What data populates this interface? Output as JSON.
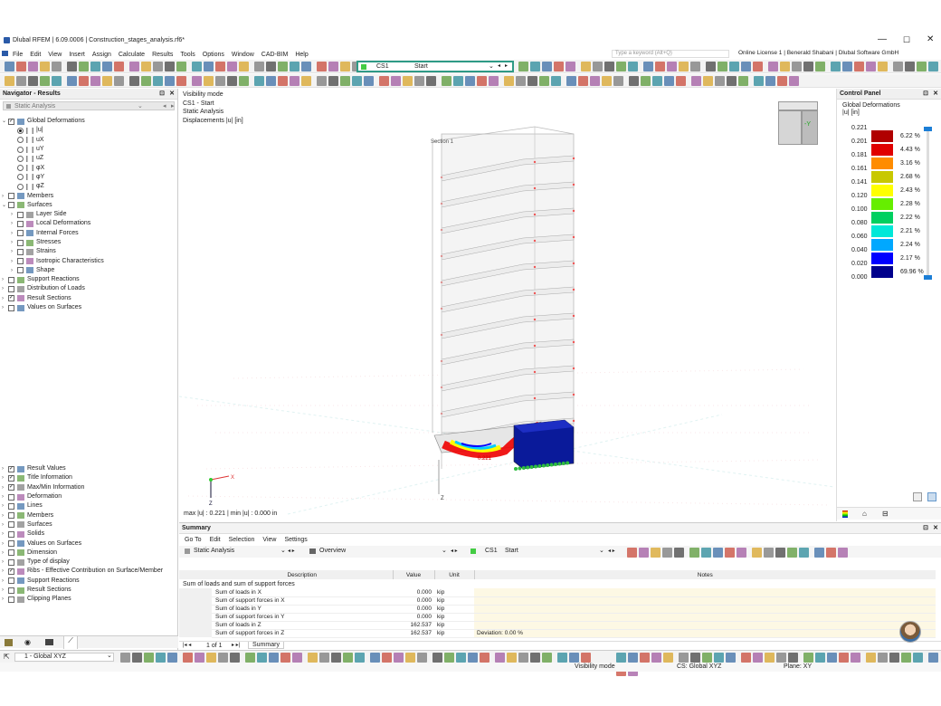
{
  "window": {
    "title": "Dlubal RFEM | 6.09.0006 | Construction_stages_analysis.rf6*"
  },
  "menu": [
    "File",
    "Edit",
    "View",
    "Insert",
    "Assign",
    "Calculate",
    "Results",
    "Tools",
    "Options",
    "Window",
    "CAD-BIM",
    "Help"
  ],
  "search": {
    "placeholder": "Type a keyword (Alt+Q)"
  },
  "license": "Online License 1 | Benerald Shabani | Dlubal Software GmbH",
  "construction_stage": {
    "id": "CS1",
    "name": "Start"
  },
  "navigator": {
    "title": "Navigator - Results",
    "analysis": "Static Analysis",
    "tree_top": [
      {
        "label": "Global Deformations",
        "level": 0,
        "checked": true,
        "expanded": true
      },
      {
        "label": "|u|",
        "level": 1,
        "radio": true,
        "selected": true
      },
      {
        "label": "uX",
        "level": 1,
        "radio": true
      },
      {
        "label": "uY",
        "level": 1,
        "radio": true
      },
      {
        "label": "uZ",
        "level": 1,
        "radio": true
      },
      {
        "label": "φX",
        "level": 1,
        "radio": true
      },
      {
        "label": "φY",
        "level": 1,
        "radio": true
      },
      {
        "label": "φZ",
        "level": 1,
        "radio": true
      },
      {
        "label": "Members",
        "level": 0,
        "checked": false
      },
      {
        "label": "Surfaces",
        "level": 0,
        "checked": false,
        "expanded": true
      },
      {
        "label": "Layer Side",
        "level": 1,
        "checked": false
      },
      {
        "label": "Local Deformations",
        "level": 1,
        "checked": false
      },
      {
        "label": "Internal Forces",
        "level": 1,
        "checked": false
      },
      {
        "label": "Stresses",
        "level": 1,
        "checked": false
      },
      {
        "label": "Strains",
        "level": 1,
        "checked": false
      },
      {
        "label": "Isotropic Characteristics",
        "level": 1,
        "checked": false
      },
      {
        "label": "Shape",
        "level": 1,
        "checked": false
      },
      {
        "label": "Support Reactions",
        "level": 0,
        "checked": false
      },
      {
        "label": "Distribution of Loads",
        "level": 0,
        "checked": false
      },
      {
        "label": "Result Sections",
        "level": 0,
        "checked": true
      },
      {
        "label": "Values on Surfaces",
        "level": 0,
        "checked": false
      }
    ],
    "tree_bottom": [
      {
        "label": "Result Values",
        "checked": true
      },
      {
        "label": "Title Information",
        "checked": true
      },
      {
        "label": "Max/Min Information",
        "checked": true
      },
      {
        "label": "Deformation",
        "checked": false
      },
      {
        "label": "Lines",
        "checked": false
      },
      {
        "label": "Members",
        "checked": false
      },
      {
        "label": "Surfaces",
        "checked": false
      },
      {
        "label": "Solids",
        "checked": false
      },
      {
        "label": "Values on Surfaces",
        "checked": false
      },
      {
        "label": "Dimension",
        "checked": false
      },
      {
        "label": "Type of display",
        "checked": false
      },
      {
        "label": "Ribs - Effective Contribution on Surface/Member",
        "checked": true
      },
      {
        "label": "Support Reactions",
        "checked": false
      },
      {
        "label": "Result Sections",
        "checked": false
      },
      {
        "label": "Clipping Planes",
        "checked": false
      }
    ]
  },
  "viewport": {
    "info": [
      "Visibility mode",
      "CS1 - Start",
      "Static Analysis",
      "Displacements |u| [in]"
    ],
    "section_label": "Section 1",
    "value_label": "0.221",
    "maxmin": "max |u| : 0.221 | min |u| : 0.000 in",
    "axis_x": "X",
    "axis_z": "Z"
  },
  "control_panel": {
    "title": "Control Panel",
    "subtitle": "Global Deformations",
    "unit": "|u| [in]",
    "legend_values": [
      "0.221",
      "0.201",
      "0.181",
      "0.161",
      "0.141",
      "0.120",
      "0.100",
      "0.080",
      "0.060",
      "0.040",
      "0.020",
      "0.000"
    ],
    "legend_colors": [
      "#b00000",
      "#e00000",
      "#ff8c00",
      "#c8c800",
      "#ffff00",
      "#66ee00",
      "#00d060",
      "#00e8d8",
      "#00a8ff",
      "#0000ff",
      "#00008c"
    ],
    "legend_percents": [
      "6.22 %",
      "4.43 %",
      "3.16 %",
      "2.68 %",
      "2.43 %",
      "2.28 %",
      "2.22 %",
      "2.21 %",
      "2.24 %",
      "2.17 %",
      "69.96 %"
    ]
  },
  "summary": {
    "title": "Summary",
    "menu": [
      "Go To",
      "Edit",
      "Selection",
      "View",
      "Settings"
    ],
    "analysis": "Static Analysis",
    "view": "Overview",
    "cs_id": "CS1",
    "cs_name": "Start",
    "columns": [
      "Description",
      "Value",
      "Unit",
      "Notes"
    ],
    "group": "Sum of loads and sum of support forces",
    "rows": [
      {
        "desc": "Sum of loads in X",
        "value": "0.000",
        "unit": "kip",
        "notes": ""
      },
      {
        "desc": "Sum of support forces in X",
        "value": "0.000",
        "unit": "kip",
        "notes": ""
      },
      {
        "desc": "Sum of loads in Y",
        "value": "0.000",
        "unit": "kip",
        "notes": ""
      },
      {
        "desc": "Sum of support forces in Y",
        "value": "0.000",
        "unit": "kip",
        "notes": ""
      },
      {
        "desc": "Sum of loads in Z",
        "value": "162.537",
        "unit": "kip",
        "notes": ""
      },
      {
        "desc": "Sum of support forces in Z",
        "value": "162.537",
        "unit": "kip",
        "notes": "Deviation: 0.00 %"
      }
    ],
    "pager": "1 of 1",
    "tab": "Summary"
  },
  "bottom_bar": {
    "coord_system": "1 - Global XYZ"
  },
  "status": {
    "mode": "Visibility mode",
    "cs": "CS: Global XYZ",
    "plane": "Plane: XY"
  }
}
